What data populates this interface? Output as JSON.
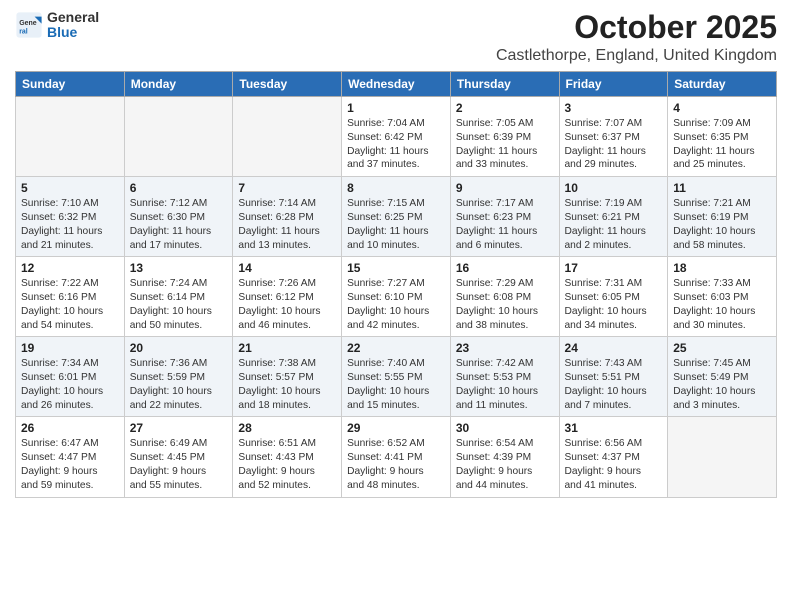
{
  "logo": {
    "general": "General",
    "blue": "Blue"
  },
  "title": "October 2025",
  "subtitle": "Castlethorpe, England, United Kingdom",
  "days_of_week": [
    "Sunday",
    "Monday",
    "Tuesday",
    "Wednesday",
    "Thursday",
    "Friday",
    "Saturday"
  ],
  "weeks": [
    [
      {
        "day": "",
        "info": ""
      },
      {
        "day": "",
        "info": ""
      },
      {
        "day": "",
        "info": ""
      },
      {
        "day": "1",
        "info": "Sunrise: 7:04 AM\nSunset: 6:42 PM\nDaylight: 11 hours\nand 37 minutes."
      },
      {
        "day": "2",
        "info": "Sunrise: 7:05 AM\nSunset: 6:39 PM\nDaylight: 11 hours\nand 33 minutes."
      },
      {
        "day": "3",
        "info": "Sunrise: 7:07 AM\nSunset: 6:37 PM\nDaylight: 11 hours\nand 29 minutes."
      },
      {
        "day": "4",
        "info": "Sunrise: 7:09 AM\nSunset: 6:35 PM\nDaylight: 11 hours\nand 25 minutes."
      }
    ],
    [
      {
        "day": "5",
        "info": "Sunrise: 7:10 AM\nSunset: 6:32 PM\nDaylight: 11 hours\nand 21 minutes."
      },
      {
        "day": "6",
        "info": "Sunrise: 7:12 AM\nSunset: 6:30 PM\nDaylight: 11 hours\nand 17 minutes."
      },
      {
        "day": "7",
        "info": "Sunrise: 7:14 AM\nSunset: 6:28 PM\nDaylight: 11 hours\nand 13 minutes."
      },
      {
        "day": "8",
        "info": "Sunrise: 7:15 AM\nSunset: 6:25 PM\nDaylight: 11 hours\nand 10 minutes."
      },
      {
        "day": "9",
        "info": "Sunrise: 7:17 AM\nSunset: 6:23 PM\nDaylight: 11 hours\nand 6 minutes."
      },
      {
        "day": "10",
        "info": "Sunrise: 7:19 AM\nSunset: 6:21 PM\nDaylight: 11 hours\nand 2 minutes."
      },
      {
        "day": "11",
        "info": "Sunrise: 7:21 AM\nSunset: 6:19 PM\nDaylight: 10 hours\nand 58 minutes."
      }
    ],
    [
      {
        "day": "12",
        "info": "Sunrise: 7:22 AM\nSunset: 6:16 PM\nDaylight: 10 hours\nand 54 minutes."
      },
      {
        "day": "13",
        "info": "Sunrise: 7:24 AM\nSunset: 6:14 PM\nDaylight: 10 hours\nand 50 minutes."
      },
      {
        "day": "14",
        "info": "Sunrise: 7:26 AM\nSunset: 6:12 PM\nDaylight: 10 hours\nand 46 minutes."
      },
      {
        "day": "15",
        "info": "Sunrise: 7:27 AM\nSunset: 6:10 PM\nDaylight: 10 hours\nand 42 minutes."
      },
      {
        "day": "16",
        "info": "Sunrise: 7:29 AM\nSunset: 6:08 PM\nDaylight: 10 hours\nand 38 minutes."
      },
      {
        "day": "17",
        "info": "Sunrise: 7:31 AM\nSunset: 6:05 PM\nDaylight: 10 hours\nand 34 minutes."
      },
      {
        "day": "18",
        "info": "Sunrise: 7:33 AM\nSunset: 6:03 PM\nDaylight: 10 hours\nand 30 minutes."
      }
    ],
    [
      {
        "day": "19",
        "info": "Sunrise: 7:34 AM\nSunset: 6:01 PM\nDaylight: 10 hours\nand 26 minutes."
      },
      {
        "day": "20",
        "info": "Sunrise: 7:36 AM\nSunset: 5:59 PM\nDaylight: 10 hours\nand 22 minutes."
      },
      {
        "day": "21",
        "info": "Sunrise: 7:38 AM\nSunset: 5:57 PM\nDaylight: 10 hours\nand 18 minutes."
      },
      {
        "day": "22",
        "info": "Sunrise: 7:40 AM\nSunset: 5:55 PM\nDaylight: 10 hours\nand 15 minutes."
      },
      {
        "day": "23",
        "info": "Sunrise: 7:42 AM\nSunset: 5:53 PM\nDaylight: 10 hours\nand 11 minutes."
      },
      {
        "day": "24",
        "info": "Sunrise: 7:43 AM\nSunset: 5:51 PM\nDaylight: 10 hours\nand 7 minutes."
      },
      {
        "day": "25",
        "info": "Sunrise: 7:45 AM\nSunset: 5:49 PM\nDaylight: 10 hours\nand 3 minutes."
      }
    ],
    [
      {
        "day": "26",
        "info": "Sunrise: 6:47 AM\nSunset: 4:47 PM\nDaylight: 9 hours\nand 59 minutes."
      },
      {
        "day": "27",
        "info": "Sunrise: 6:49 AM\nSunset: 4:45 PM\nDaylight: 9 hours\nand 55 minutes."
      },
      {
        "day": "28",
        "info": "Sunrise: 6:51 AM\nSunset: 4:43 PM\nDaylight: 9 hours\nand 52 minutes."
      },
      {
        "day": "29",
        "info": "Sunrise: 6:52 AM\nSunset: 4:41 PM\nDaylight: 9 hours\nand 48 minutes."
      },
      {
        "day": "30",
        "info": "Sunrise: 6:54 AM\nSunset: 4:39 PM\nDaylight: 9 hours\nand 44 minutes."
      },
      {
        "day": "31",
        "info": "Sunrise: 6:56 AM\nSunset: 4:37 PM\nDaylight: 9 hours\nand 41 minutes."
      },
      {
        "day": "",
        "info": ""
      }
    ]
  ]
}
